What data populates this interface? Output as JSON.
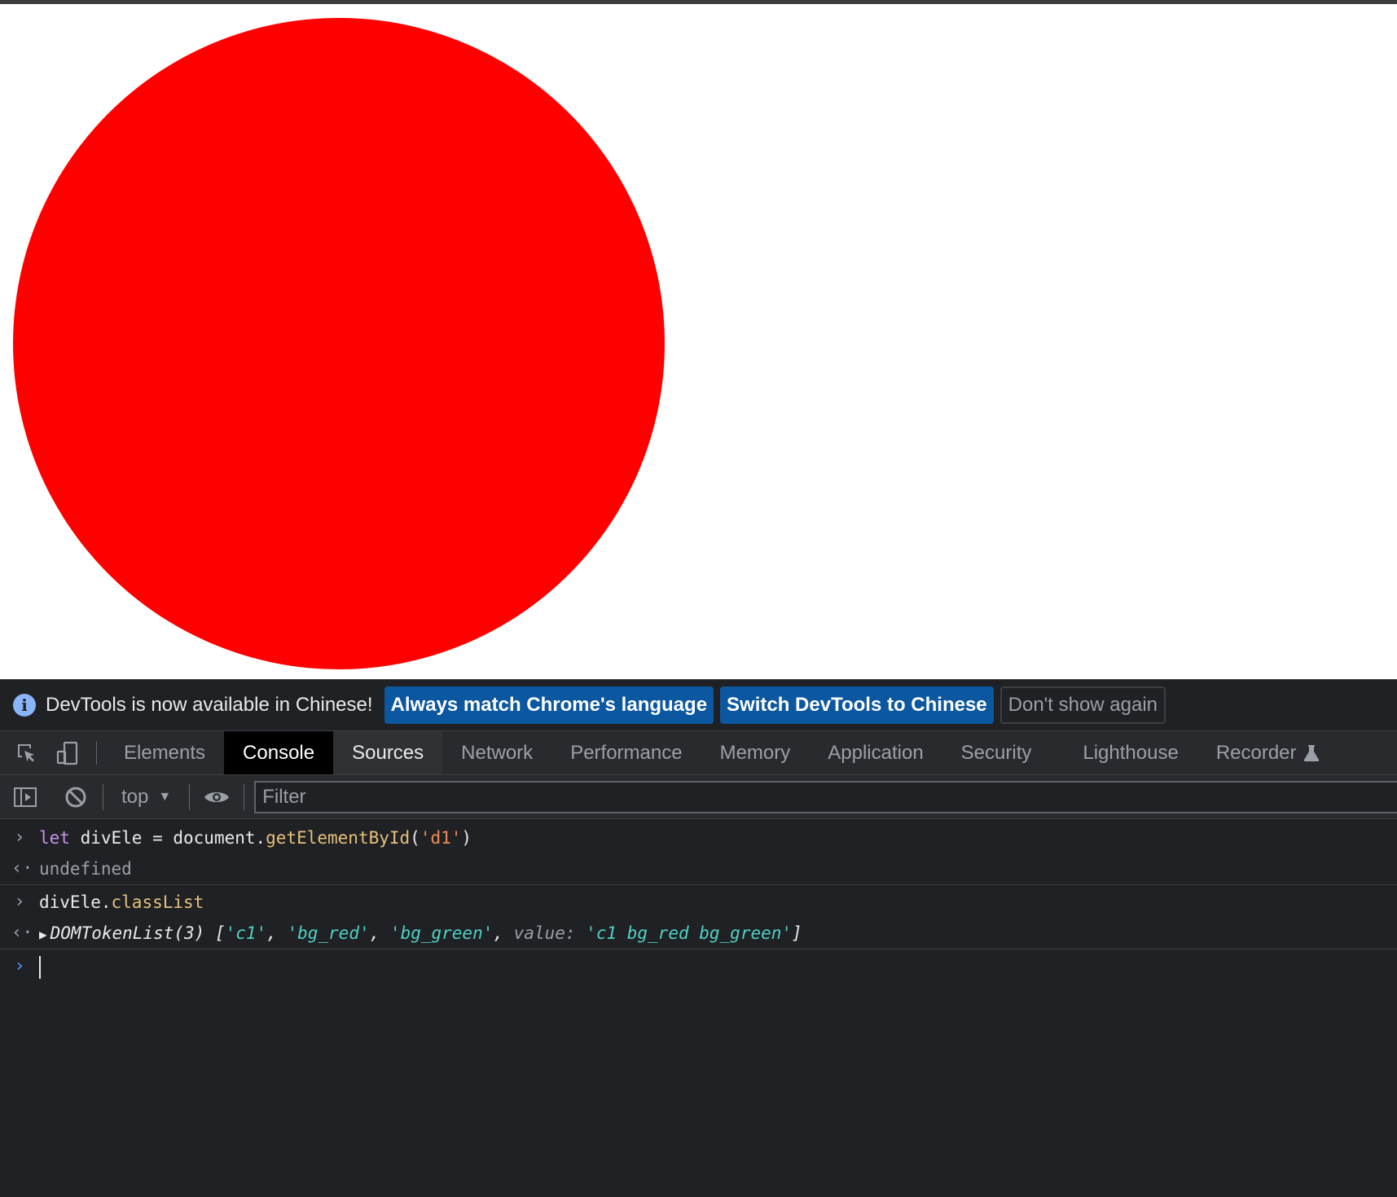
{
  "page": {
    "circle_color": "#ff0000"
  },
  "infobar": {
    "icon": "info-icon",
    "icon_glyph": "i",
    "icon_color": "#8ab4f8",
    "message": "DevTools is now available in Chinese!",
    "btn_match": "Always match Chrome's language",
    "btn_switch": "Switch DevTools to Chinese",
    "btn_dismiss": "Don't show again",
    "primary_color": "#0b57a0"
  },
  "tabs": {
    "inspect_icon": "inspect-element-icon",
    "device_icon": "device-toolbar-icon",
    "items": [
      "Elements",
      "Console",
      "Sources",
      "Network",
      "Performance",
      "Memory",
      "Application",
      "Security",
      "Lighthouse",
      "Recorder"
    ],
    "active": "Console",
    "recorder_icon": "flask-icon"
  },
  "console_toolbar": {
    "sidebar_icon": "sidebar-toggle-icon",
    "clear_icon": "clear-console-icon",
    "context": "top",
    "eye_icon": "live-expression-icon",
    "filter_placeholder": "Filter"
  },
  "console": {
    "line1": {
      "kw": "let",
      "plain1": " divEle = document.",
      "fn": "getElementById",
      "open": "(",
      "arg": "'d1'",
      "close": ")"
    },
    "line2": "undefined",
    "line3": {
      "obj": "divEle.",
      "prop": "classList"
    },
    "line4": {
      "type": "DOMTokenList(3)",
      "open": " [",
      "v1": "'c1'",
      "c1": ", ",
      "v2": "'bg_red'",
      "c2": ", ",
      "v3": "'bg_green'",
      "c3": ", ",
      "key": "value",
      "colon": ": ",
      "v4": "'c1 bg_red bg_green'",
      "close": "]"
    }
  }
}
